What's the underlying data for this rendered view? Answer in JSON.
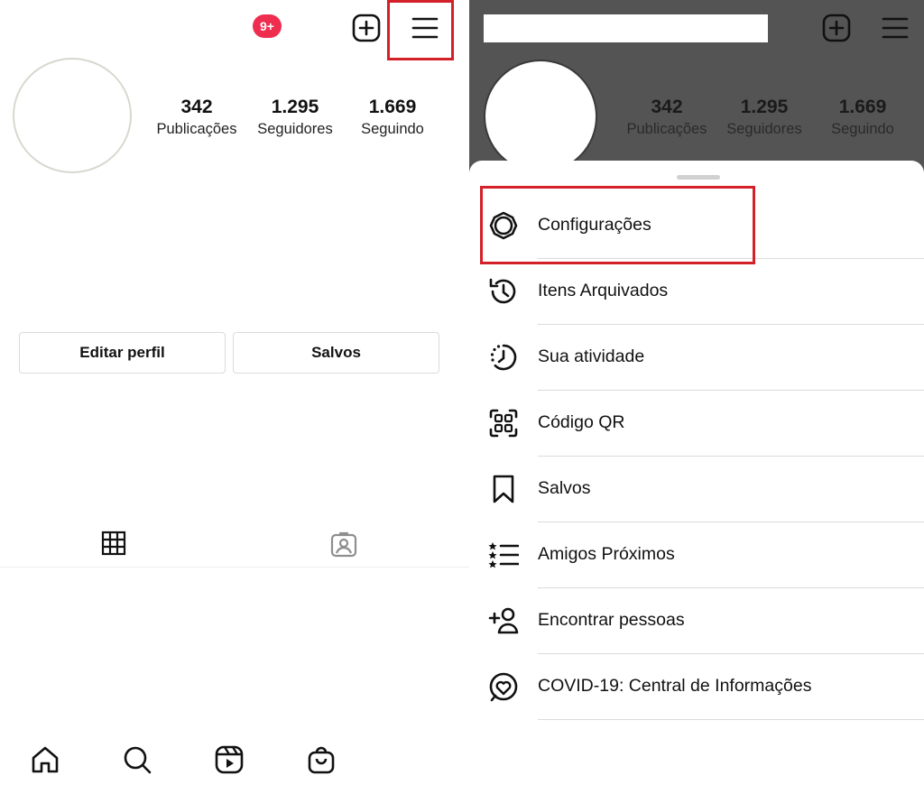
{
  "left": {
    "notification_badge": "9+",
    "stats": [
      {
        "value": "342",
        "label": "Publicações"
      },
      {
        "value": "1.295",
        "label": "Seguidores"
      },
      {
        "value": "1.669",
        "label": "Seguindo"
      }
    ],
    "edit_profile_label": "Editar perfil",
    "saved_label": "Salvos"
  },
  "right": {
    "stats": [
      {
        "value": "342",
        "label": "Publicações"
      },
      {
        "value": "1.295",
        "label": "Seguidores"
      },
      {
        "value": "1.669",
        "label": "Seguindo"
      }
    ],
    "menu": [
      {
        "label": "Configurações",
        "icon": "settings-gear-icon"
      },
      {
        "label": "Itens Arquivados",
        "icon": "archive-history-icon"
      },
      {
        "label": "Sua atividade",
        "icon": "activity-clock-icon"
      },
      {
        "label": "Código QR",
        "icon": "qr-code-icon"
      },
      {
        "label": "Salvos",
        "icon": "bookmark-icon"
      },
      {
        "label": "Amigos Próximos",
        "icon": "close-friends-list-icon"
      },
      {
        "label": "Encontrar pessoas",
        "icon": "add-person-icon"
      },
      {
        "label": "COVID-19: Central de Informações",
        "icon": "covid-info-heart-icon"
      }
    ]
  },
  "colors": {
    "badge": "#ee2d4f",
    "highlight_box": "#d32029",
    "overlay_dim": "#545454"
  }
}
